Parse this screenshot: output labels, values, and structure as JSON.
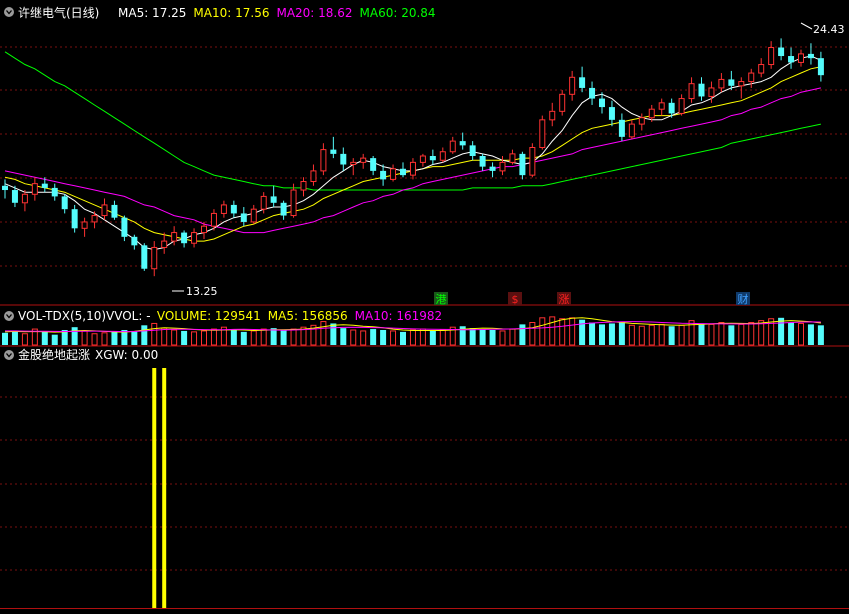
{
  "main_panel": {
    "title": "许继电气(日线)",
    "indicators": [
      {
        "label": "MA5: 17.25",
        "color": "#FFFFFF"
      },
      {
        "label": "MA10: 17.56",
        "color": "#FFFF00"
      },
      {
        "label": "MA20: 18.62",
        "color": "#FF00FF"
      },
      {
        "label": "MA60: 20.84",
        "color": "#00FF00"
      }
    ],
    "high_label": "24.43",
    "low_label": "13.25",
    "markers": [
      {
        "text": "港",
        "color": "#00FF00",
        "box": "#1A5A1A"
      },
      {
        "text": "$",
        "color": "#FF2020",
        "box": "#5A1010"
      },
      {
        "text": "涨",
        "color": "#FF2020",
        "box": "#5A1010"
      },
      {
        "text": "财",
        "color": "#40A0FF",
        "box": "#103A6A"
      }
    ]
  },
  "volume_panel": {
    "title": "VOL-TDX(5,10)",
    "indicators": [
      {
        "label": "VVOL: -",
        "color": "#FFFFFF"
      },
      {
        "label": "VOLUME: 129541",
        "color": "#FFFF00"
      },
      {
        "label": "MA5: 156856",
        "color": "#FFFF00"
      },
      {
        "label": "MA10: 161982",
        "color": "#FF00FF"
      }
    ]
  },
  "signal_panel": {
    "title": "金股绝地起涨",
    "indicators": [
      {
        "label": "XGW: 0.00",
        "color": "#FFFFFF"
      }
    ]
  },
  "colors": {
    "up": "#FF3232",
    "down": "#54FCFC",
    "ma5": "#FFFFFF",
    "ma10": "#FFFF00",
    "ma20": "#FF00FF",
    "ma60": "#00FF00",
    "signal": "#FFFF00",
    "grid": "#7A1010",
    "frame": "#B01010"
  },
  "chart_data": {
    "type": "candlestick",
    "y_range": [
      12.6,
      25.2
    ],
    "ohlc": [
      [
        17.5,
        17.8,
        16.9,
        17.3
      ],
      [
        17.3,
        17.5,
        16.5,
        16.7
      ],
      [
        16.7,
        17.3,
        16.3,
        17.1
      ],
      [
        17.1,
        17.9,
        16.8,
        17.6
      ],
      [
        17.6,
        17.9,
        17.2,
        17.4
      ],
      [
        17.4,
        17.6,
        16.8,
        17.0
      ],
      [
        17.0,
        17.1,
        16.2,
        16.4
      ],
      [
        16.4,
        16.6,
        15.3,
        15.5
      ],
      [
        15.5,
        16.0,
        15.1,
        15.8
      ],
      [
        15.8,
        16.3,
        15.5,
        16.1
      ],
      [
        16.1,
        16.9,
        15.9,
        16.6
      ],
      [
        16.6,
        16.8,
        15.9,
        16.0
      ],
      [
        16.0,
        16.1,
        14.9,
        15.1
      ],
      [
        15.1,
        15.2,
        14.5,
        14.7
      ],
      [
        14.7,
        14.8,
        13.5,
        13.6
      ],
      [
        13.6,
        14.9,
        13.25,
        14.6
      ],
      [
        14.6,
        15.3,
        14.3,
        14.9
      ],
      [
        14.9,
        15.6,
        14.7,
        15.3
      ],
      [
        15.3,
        15.4,
        14.6,
        14.8
      ],
      [
        14.8,
        15.5,
        14.6,
        15.3
      ],
      [
        15.3,
        15.8,
        15.0,
        15.6
      ],
      [
        15.6,
        16.4,
        15.4,
        16.2
      ],
      [
        16.2,
        16.8,
        16.0,
        16.6
      ],
      [
        16.6,
        16.8,
        16.0,
        16.2
      ],
      [
        16.2,
        16.5,
        15.6,
        15.8
      ],
      [
        15.8,
        16.6,
        15.7,
        16.4
      ],
      [
        16.4,
        17.2,
        16.2,
        17.0
      ],
      [
        17.0,
        17.5,
        16.5,
        16.7
      ],
      [
        16.7,
        16.8,
        15.9,
        16.1
      ],
      [
        16.1,
        17.6,
        16.0,
        17.3
      ],
      [
        17.3,
        17.9,
        17.0,
        17.7
      ],
      [
        17.7,
        18.5,
        17.5,
        18.2
      ],
      [
        18.2,
        19.5,
        18.0,
        19.2
      ],
      [
        19.2,
        19.8,
        18.8,
        19.0
      ],
      [
        19.0,
        19.3,
        18.2,
        18.5
      ],
      [
        18.5,
        18.8,
        18.0,
        18.6
      ],
      [
        18.6,
        19.0,
        18.3,
        18.8
      ],
      [
        18.8,
        18.9,
        18.0,
        18.2
      ],
      [
        18.2,
        18.5,
        17.5,
        17.8
      ],
      [
        17.8,
        18.5,
        17.7,
        18.3
      ],
      [
        18.3,
        18.6,
        17.9,
        18.0
      ],
      [
        18.0,
        18.8,
        17.8,
        18.6
      ],
      [
        18.6,
        19.0,
        18.4,
        18.9
      ],
      [
        18.9,
        19.2,
        18.5,
        18.7
      ],
      [
        18.7,
        19.3,
        18.6,
        19.1
      ],
      [
        19.1,
        19.8,
        19.0,
        19.6
      ],
      [
        19.6,
        20.0,
        19.2,
        19.4
      ],
      [
        19.4,
        19.6,
        18.7,
        18.9
      ],
      [
        18.9,
        19.0,
        18.2,
        18.4
      ],
      [
        18.4,
        18.6,
        17.9,
        18.2
      ],
      [
        18.2,
        18.9,
        18.0,
        18.6
      ],
      [
        18.6,
        19.2,
        18.5,
        19.0
      ],
      [
        19.0,
        19.1,
        17.8,
        18.0
      ],
      [
        18.0,
        19.5,
        17.9,
        19.3
      ],
      [
        19.3,
        20.8,
        19.2,
        20.6
      ],
      [
        20.6,
        21.4,
        20.3,
        21.0
      ],
      [
        21.0,
        22.0,
        20.8,
        21.8
      ],
      [
        21.8,
        22.9,
        21.5,
        22.6
      ],
      [
        22.6,
        23.1,
        21.9,
        22.1
      ],
      [
        22.1,
        22.4,
        21.3,
        21.6
      ],
      [
        21.6,
        21.9,
        20.9,
        21.2
      ],
      [
        21.2,
        21.5,
        20.3,
        20.6
      ],
      [
        20.6,
        20.9,
        19.6,
        19.8
      ],
      [
        19.8,
        20.6,
        19.7,
        20.4
      ],
      [
        20.4,
        20.9,
        20.1,
        20.7
      ],
      [
        20.7,
        21.3,
        20.5,
        21.1
      ],
      [
        21.1,
        21.6,
        20.8,
        21.4
      ],
      [
        21.4,
        21.6,
        20.7,
        20.9
      ],
      [
        20.9,
        21.8,
        20.8,
        21.6
      ],
      [
        21.6,
        22.6,
        21.4,
        22.3
      ],
      [
        22.3,
        22.6,
        21.5,
        21.7
      ],
      [
        21.7,
        22.4,
        21.4,
        22.1
      ],
      [
        22.1,
        22.8,
        21.9,
        22.5
      ],
      [
        22.5,
        22.9,
        22.0,
        22.2
      ],
      [
        22.2,
        22.6,
        21.6,
        22.4
      ],
      [
        22.4,
        23.0,
        22.1,
        22.8
      ],
      [
        22.8,
        23.5,
        22.6,
        23.2
      ],
      [
        23.2,
        24.3,
        23.0,
        24.0
      ],
      [
        24.0,
        24.43,
        23.4,
        23.6
      ],
      [
        23.6,
        24.0,
        23.0,
        23.3
      ],
      [
        23.3,
        23.9,
        23.1,
        23.7
      ],
      [
        23.7,
        24.2,
        23.2,
        23.5
      ],
      [
        23.5,
        23.8,
        22.4,
        22.7
      ]
    ],
    "ma5": [
      17.6,
      17.4,
      17.2,
      17.2,
      17.2,
      17.2,
      17.1,
      16.8,
      16.4,
      16.2,
      15.9,
      15.6,
      15.3,
      15.0,
      14.6,
      14.5,
      14.6,
      14.9,
      15.0,
      15.2,
      15.3,
      15.5,
      15.8,
      16.0,
      16.1,
      16.2,
      16.4,
      16.5,
      16.5,
      16.6,
      16.8,
      17.1,
      17.5,
      17.9,
      18.2,
      18.5,
      18.7,
      18.6,
      18.4,
      18.3,
      18.2,
      18.2,
      18.3,
      18.5,
      18.6,
      18.8,
      19.0,
      19.1,
      19.0,
      18.9,
      18.7,
      18.6,
      18.5,
      18.6,
      19.0,
      19.6,
      20.1,
      20.8,
      21.4,
      21.7,
      21.8,
      21.6,
      21.2,
      20.9,
      20.7,
      20.6,
      20.6,
      20.8,
      21.0,
      21.3,
      21.4,
      21.6,
      21.9,
      22.1,
      22.2,
      22.3,
      22.4,
      22.6,
      23.0,
      23.3,
      23.5,
      23.6,
      23.4
    ],
    "ma10": [
      17.9,
      17.8,
      17.6,
      17.5,
      17.4,
      17.3,
      17.2,
      17.0,
      16.8,
      16.6,
      16.4,
      16.2,
      16.0,
      15.8,
      15.5,
      15.3,
      15.2,
      15.1,
      15.0,
      14.9,
      14.9,
      15.0,
      15.2,
      15.4,
      15.6,
      15.7,
      15.9,
      16.1,
      16.2,
      16.3,
      16.4,
      16.6,
      16.9,
      17.1,
      17.3,
      17.5,
      17.7,
      17.8,
      17.9,
      18.0,
      18.1,
      18.2,
      18.3,
      18.4,
      18.4,
      18.5,
      18.6,
      18.7,
      18.7,
      18.7,
      18.7,
      18.7,
      18.8,
      18.8,
      18.9,
      19.1,
      19.4,
      19.7,
      20.0,
      20.2,
      20.3,
      20.4,
      20.5,
      20.6,
      20.7,
      20.8,
      20.8,
      20.8,
      20.9,
      21.0,
      21.1,
      21.2,
      21.3,
      21.4,
      21.5,
      21.7,
      21.9,
      22.1,
      22.4,
      22.6,
      22.8,
      23.0,
      23.1
    ],
    "ma20": [
      18.2,
      18.1,
      18.0,
      17.9,
      17.8,
      17.7,
      17.6,
      17.5,
      17.4,
      17.3,
      17.2,
      17.1,
      17.0,
      16.8,
      16.6,
      16.5,
      16.3,
      16.1,
      16.0,
      15.9,
      15.7,
      15.6,
      15.5,
      15.4,
      15.3,
      15.3,
      15.3,
      15.4,
      15.5,
      15.6,
      15.7,
      15.8,
      16.0,
      16.1,
      16.3,
      16.5,
      16.7,
      16.8,
      17.0,
      17.1,
      17.3,
      17.4,
      17.6,
      17.7,
      17.8,
      17.9,
      18.0,
      18.1,
      18.2,
      18.3,
      18.4,
      18.4,
      18.5,
      18.6,
      18.7,
      18.8,
      18.9,
      19.0,
      19.2,
      19.3,
      19.4,
      19.5,
      19.6,
      19.7,
      19.8,
      19.9,
      20.0,
      20.1,
      20.2,
      20.3,
      20.4,
      20.5,
      20.6,
      20.8,
      20.9,
      21.1,
      21.2,
      21.4,
      21.6,
      21.7,
      21.9,
      22.0,
      22.1
    ],
    "ma60": [
      23.8,
      23.5,
      23.2,
      23.0,
      22.7,
      22.4,
      22.2,
      21.9,
      21.6,
      21.3,
      21.0,
      20.7,
      20.4,
      20.1,
      19.8,
      19.5,
      19.2,
      18.9,
      18.6,
      18.4,
      18.2,
      18.0,
      17.9,
      17.8,
      17.7,
      17.6,
      17.5,
      17.5,
      17.4,
      17.4,
      17.4,
      17.3,
      17.3,
      17.3,
      17.3,
      17.3,
      17.3,
      17.3,
      17.3,
      17.3,
      17.3,
      17.3,
      17.3,
      17.3,
      17.3,
      17.3,
      17.3,
      17.4,
      17.4,
      17.4,
      17.4,
      17.4,
      17.5,
      17.5,
      17.5,
      17.6,
      17.7,
      17.8,
      17.9,
      18.0,
      18.1,
      18.2,
      18.3,
      18.4,
      18.5,
      18.6,
      18.7,
      18.8,
      18.9,
      19.0,
      19.1,
      19.2,
      19.3,
      19.5,
      19.6,
      19.7,
      19.8,
      19.9,
      20.0,
      20.1,
      20.2,
      20.3,
      20.4
    ],
    "volume": [
      130,
      150,
      120,
      170,
      140,
      110,
      160,
      190,
      150,
      120,
      130,
      140,
      160,
      150,
      210,
      230,
      180,
      160,
      150,
      140,
      150,
      170,
      190,
      160,
      140,
      150,
      170,
      180,
      160,
      170,
      190,
      210,
      250,
      230,
      180,
      160,
      150,
      170,
      160,
      150,
      140,
      160,
      170,
      150,
      160,
      190,
      200,
      180,
      170,
      160,
      150,
      170,
      220,
      240,
      290,
      300,
      280,
      290,
      270,
      240,
      220,
      230,
      250,
      210,
      200,
      210,
      220,
      200,
      210,
      260,
      230,
      220,
      240,
      210,
      220,
      240,
      260,
      280,
      290,
      240,
      230,
      220,
      210
    ],
    "vol_ma5": [
      140,
      145,
      142,
      144,
      142,
      138,
      140,
      150,
      155,
      150,
      145,
      140,
      138,
      145,
      160,
      175,
      185,
      180,
      175,
      165,
      160,
      158,
      160,
      163,
      160,
      155,
      158,
      162,
      163,
      165,
      170,
      180,
      195,
      210,
      215,
      210,
      200,
      195,
      185,
      170,
      160,
      155,
      155,
      155,
      155,
      160,
      168,
      175,
      180,
      178,
      172,
      170,
      175,
      185,
      210,
      240,
      270,
      285,
      290,
      280,
      265,
      250,
      240,
      230,
      225,
      220,
      215,
      212,
      210,
      215,
      220,
      225,
      230,
      232,
      230,
      228,
      235,
      245,
      255,
      260,
      255,
      248,
      235
    ],
    "vol_ma10": [
      150,
      150,
      148,
      147,
      146,
      145,
      144,
      145,
      147,
      148,
      147,
      145,
      143,
      144,
      150,
      158,
      165,
      168,
      168,
      166,
      164,
      162,
      163,
      166,
      168,
      165,
      162,
      160,
      158,
      160,
      164,
      170,
      178,
      185,
      188,
      190,
      188,
      186,
      183,
      180,
      176,
      172,
      170,
      168,
      166,
      165,
      163,
      162,
      165,
      168,
      170,
      172,
      175,
      178,
      182,
      190,
      200,
      212,
      225,
      235,
      240,
      245,
      248,
      250,
      248,
      245,
      240,
      236,
      232,
      230,
      228,
      226,
      225,
      225,
      224,
      224,
      226,
      230,
      235,
      240,
      244,
      246,
      245
    ],
    "signal_bars": [
      15,
      16
    ]
  }
}
